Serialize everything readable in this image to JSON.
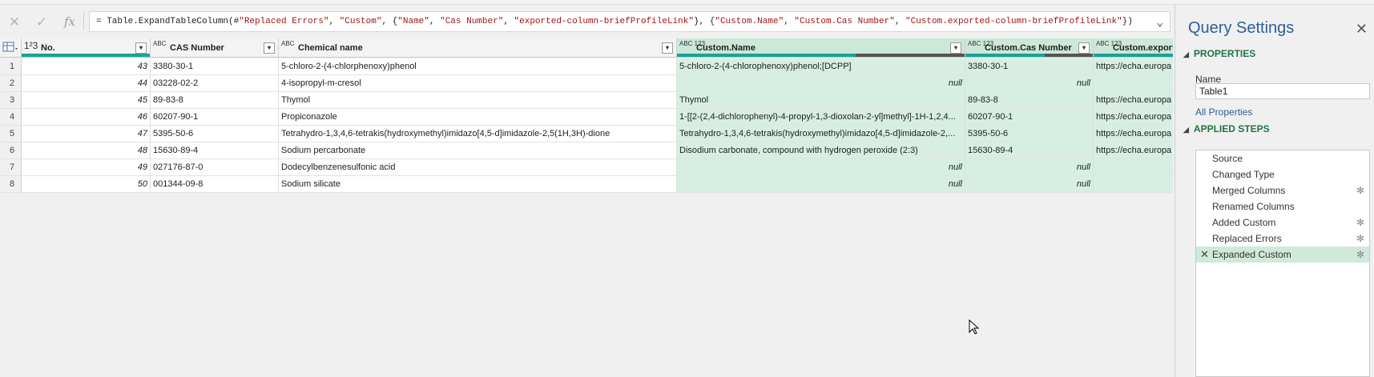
{
  "formula_bar": {
    "prefix": "= Table.ExpandTableColumn(#",
    "s1": "\"Replaced Errors\"",
    "c1": ", ",
    "s2": "\"Custom\"",
    "c2": ", {",
    "s3": "\"Name\"",
    "c3": ", ",
    "s4": "\"Cas Number\"",
    "c4": ", ",
    "s5": "\"exported-column-briefProfileLink\"",
    "c5": "}, {",
    "s6": "\"Custom.Name\"",
    "c6": ", ",
    "s7": "\"Custom.Cas Number\"",
    "c7": ", ",
    "s8": "\"Custom.exported-column-briefProfileLink\"",
    "c8": "})",
    "cancel_icon": "close-icon",
    "commit_icon": "check-icon",
    "fx_label": "fx"
  },
  "columns": [
    {
      "type": "1²3",
      "name": "No."
    },
    {
      "type": "ABC",
      "name": "CAS Number"
    },
    {
      "type": "ABC",
      "name": "Chemical name"
    },
    {
      "type": "ABC 123",
      "name": "Custom.Name"
    },
    {
      "type": "ABC 123",
      "name": "Custom.Cas Number"
    },
    {
      "type": "ABC 123",
      "name": "Custom.export"
    }
  ],
  "rows": [
    {
      "n": "1",
      "no": "43",
      "cas": "3380-30-1",
      "chem": "5-chloro-2-(4-chlorphenoxy)phenol",
      "cname": "5-chloro-2-(4-chlorophenoxy)phenol;[DCPP]",
      "ccas": "3380-30-1",
      "clink": "https://echa.europa"
    },
    {
      "n": "2",
      "no": "44",
      "cas": "03228-02-2",
      "chem": "4-isopropyl-m-cresol",
      "cname": "null",
      "ccas": "null",
      "clink": ""
    },
    {
      "n": "3",
      "no": "45",
      "cas": "89-83-8",
      "chem": "Thymol",
      "cname": "Thymol",
      "ccas": "89-83-8",
      "clink": "https://echa.europa"
    },
    {
      "n": "4",
      "no": "46",
      "cas": "60207-90-1",
      "chem": "Propiconazole",
      "cname": "1-[[2-(2,4-dichlorophenyl)-4-propyl-1,3-dioxolan-2-yl]methyl]-1H-1,2,4...",
      "ccas": "60207-90-1",
      "clink": "https://echa.europa"
    },
    {
      "n": "5",
      "no": "47",
      "cas": "5395-50-6",
      "chem": "Tetrahydro-1,3,4,6-tetrakis(hydroxymethyl)imidazo[4,5-d]imidazole-2,5(1H,3H)-dione",
      "cname": "Tetrahydro-1,3,4,6-tetrakis(hydroxymethyl)imidazo[4,5-d]imidazole-2,...",
      "ccas": "5395-50-6",
      "clink": "https://echa.europa"
    },
    {
      "n": "6",
      "no": "48",
      "cas": "15630-89-4",
      "chem": "Sodium percarbonate",
      "cname": "Disodium carbonate, compound with hydrogen peroxide (2:3)",
      "ccas": "15630-89-4",
      "clink": "https://echa.europa"
    },
    {
      "n": "7",
      "no": "49",
      "cas": "027176-87-0",
      "chem": "Dodecylbenzenesulfonic acid",
      "cname": "null",
      "ccas": "null",
      "clink": ""
    },
    {
      "n": "8",
      "no": "50",
      "cas": "001344-09-8",
      "chem": "Sodium silicate",
      "cname": "null",
      "ccas": "null",
      "clink": ""
    }
  ],
  "query_settings": {
    "title": "Query Settings",
    "properties_header": "PROPERTIES",
    "name_label": "Name",
    "name_value": "Table1",
    "all_properties": "All Properties",
    "applied_steps_header": "APPLIED STEPS",
    "steps": [
      {
        "label": "Source",
        "gear": false
      },
      {
        "label": "Changed Type",
        "gear": false
      },
      {
        "label": "Merged Columns",
        "gear": true
      },
      {
        "label": "Renamed Columns",
        "gear": false
      },
      {
        "label": "Added Custom",
        "gear": true
      },
      {
        "label": "Replaced Errors",
        "gear": true
      },
      {
        "label": "Expanded Custom",
        "gear": true,
        "selected": true
      }
    ]
  },
  "colors": {
    "accent": "#217346",
    "quality_bar": "#17a398",
    "selected_step": "#cfe9db",
    "custom_col": "#d6efe2"
  }
}
